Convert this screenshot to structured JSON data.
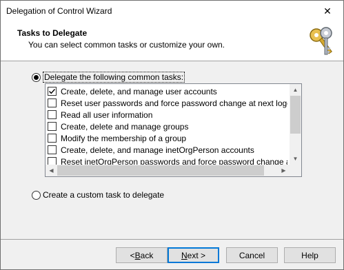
{
  "window": {
    "title": "Delegation of Control Wizard",
    "close_glyph": "✕"
  },
  "header": {
    "title": "Tasks to Delegate",
    "subtitle": "You can select common tasks or customize your own.",
    "icon": "keys-icon"
  },
  "options": {
    "common": {
      "label": "Delegate the following common tasks:",
      "selected": true
    },
    "custom": {
      "label": "Create a custom task to delegate",
      "selected": false
    }
  },
  "tasks": [
    {
      "label": "Create, delete, and manage user accounts",
      "checked": true
    },
    {
      "label": "Reset user passwords and force password change at next logon",
      "checked": false
    },
    {
      "label": "Read all user information",
      "checked": false
    },
    {
      "label": "Create, delete and manage groups",
      "checked": false
    },
    {
      "label": "Modify the membership of a group",
      "checked": false
    },
    {
      "label": "Create, delete, and manage inetOrgPerson accounts",
      "checked": false
    },
    {
      "label": "Reset inetOrgPerson passwords and force password change at next lo",
      "checked": false
    }
  ],
  "buttons": {
    "back_prefix": "< ",
    "back_key": "B",
    "back_rest": "ack",
    "next_key": "N",
    "next_rest": "ext >",
    "cancel": "Cancel",
    "help": "Help"
  }
}
